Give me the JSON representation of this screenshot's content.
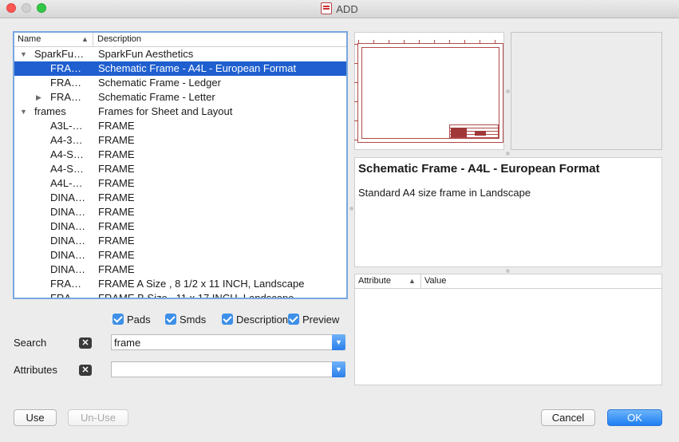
{
  "window": {
    "title": "ADD"
  },
  "tree": {
    "headers": {
      "name": "Name",
      "description": "Description"
    },
    "rows": [
      {
        "name": "SparkFu…",
        "description": "SparkFun Aesthetics",
        "expander": "expanded",
        "level": 0,
        "selected": false
      },
      {
        "name": "FRA…",
        "description": "Schematic Frame - A4L - European Format",
        "expander": "",
        "level": 1,
        "selected": true
      },
      {
        "name": "FRA…",
        "description": "Schematic Frame - Ledger",
        "expander": "",
        "level": 1,
        "selected": false
      },
      {
        "name": "FRA…",
        "description": "Schematic Frame - Letter",
        "expander": "collapsed",
        "level": 1,
        "selected": false
      },
      {
        "name": "frames",
        "description": "Frames for Sheet and Layout",
        "expander": "expanded",
        "level": 0,
        "selected": false
      },
      {
        "name": "A3L-…",
        "description": "FRAME",
        "expander": "",
        "level": 1,
        "selected": false
      },
      {
        "name": "A4-3…",
        "description": "FRAME",
        "expander": "",
        "level": 1,
        "selected": false
      },
      {
        "name": "A4-S…",
        "description": "FRAME",
        "expander": "",
        "level": 1,
        "selected": false
      },
      {
        "name": "A4-S…",
        "description": "FRAME",
        "expander": "",
        "level": 1,
        "selected": false
      },
      {
        "name": "A4L-…",
        "description": "FRAME",
        "expander": "",
        "level": 1,
        "selected": false
      },
      {
        "name": "DINA…",
        "description": "FRAME",
        "expander": "",
        "level": 1,
        "selected": false
      },
      {
        "name": "DINA…",
        "description": "FRAME",
        "expander": "",
        "level": 1,
        "selected": false
      },
      {
        "name": "DINA…",
        "description": "FRAME",
        "expander": "",
        "level": 1,
        "selected": false
      },
      {
        "name": "DINA…",
        "description": "FRAME",
        "expander": "",
        "level": 1,
        "selected": false
      },
      {
        "name": "DINA…",
        "description": "FRAME",
        "expander": "",
        "level": 1,
        "selected": false
      },
      {
        "name": "DINA…",
        "description": "FRAME",
        "expander": "",
        "level": 1,
        "selected": false
      },
      {
        "name": "FRA…",
        "description": "FRAME A Size , 8 1/2 x 11 INCH, Landscape",
        "expander": "",
        "level": 1,
        "selected": false
      },
      {
        "name": "FRA…",
        "description": "FRAME B Size , 11 x 17 INCH, Landscape",
        "expander": "",
        "level": 1,
        "selected": false
      }
    ]
  },
  "filters": {
    "pads": {
      "label": "Pads",
      "checked": true
    },
    "smds": {
      "label": "Smds",
      "checked": true
    },
    "description": {
      "label": "Description",
      "checked": true
    },
    "preview": {
      "label": "Preview",
      "checked": true
    }
  },
  "search": {
    "label": "Search",
    "value": "frame"
  },
  "attributes": {
    "label": "Attributes",
    "value": ""
  },
  "detail": {
    "title": "Schematic Frame - A4L - European Format",
    "body": "Standard A4 size frame in Landscape"
  },
  "attribute_table": {
    "headers": {
      "attribute": "Attribute",
      "value": "Value"
    }
  },
  "buttons": {
    "use": "Use",
    "unuse": "Un-Use",
    "cancel": "Cancel",
    "ok": "OK"
  },
  "colors": {
    "selection": "#1f5fcf",
    "accent": "#3d8fe8",
    "frame_line": "#b04a4a"
  }
}
